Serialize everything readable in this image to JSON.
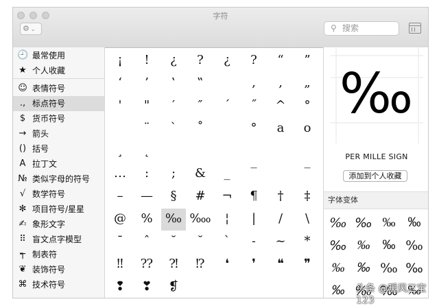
{
  "window": {
    "title": "字符"
  },
  "toolbar": {
    "gear_icon": "⚙",
    "chevron_icon": "⌄",
    "search_placeholder": "搜索",
    "search_icon": "⚲"
  },
  "sidebar": {
    "items": [
      {
        "icon": "🕘",
        "label": "最常使用"
      },
      {
        "icon": "★",
        "label": "个人收藏"
      },
      {
        "icon": "☺",
        "label": "表情符号"
      },
      {
        "icon": ".,",
        "label": "标点符号"
      },
      {
        "icon": "$",
        "label": "货币符号"
      },
      {
        "icon": "→",
        "label": "箭头"
      },
      {
        "icon": "()",
        "label": "括号"
      },
      {
        "icon": "A",
        "label": "拉丁文"
      },
      {
        "icon": "№",
        "label": "类似字母的符号"
      },
      {
        "icon": "√",
        "label": "数学符号"
      },
      {
        "icon": "✻",
        "label": "项目符号/星星"
      },
      {
        "icon": "✍",
        "label": "象形文字"
      },
      {
        "icon": "⠿",
        "label": "盲文点字模型"
      },
      {
        "icon": "┭",
        "label": "制表符"
      },
      {
        "icon": "❦",
        "label": "装饰符号"
      },
      {
        "icon": "⌘",
        "label": "技术符号"
      }
    ],
    "selected_index": 3
  },
  "grid": {
    "rows": [
      [
        "¡",
        "!",
        "¿",
        "?",
        "¿",
        "?",
        "“",
        "”"
      ],
      [
        "‘",
        "’",
        "‛",
        "‟",
        "",
        ",",
        "‚",
        "„"
      ],
      [
        "'",
        "\"",
        "′",
        "″",
        "ˊ",
        "˝",
        "^",
        "°"
      ],
      [
        "",
        "¨",
        "`",
        "˚",
        "",
        "°",
        "a",
        "o"
      ],
      [
        "¸",
        "˛",
        "",
        "",
        "",
        "",
        "",
        ""
      ],
      [
        "…",
        ":",
        ";",
        "&",
        "_",
        "‾",
        "",
        "‾"
      ],
      [
        "–",
        "—",
        "§",
        "#",
        "¬",
        "¶",
        "†",
        "‡"
      ],
      [
        "@",
        "%",
        "‰",
        "‱",
        "¦",
        "|",
        "/",
        "\\"
      ],
      [
        "ˉ",
        "ˆ",
        "˘",
        "˘",
        "ˋ",
        "˗",
        "~",
        "*"
      ],
      [
        "‼",
        "⁇",
        "⁈",
        "⁉",
        "❛",
        "❜",
        "❝",
        "❞"
      ],
      [
        "❢",
        "❣",
        "❡",
        "",
        "",
        "",
        "",
        ""
      ]
    ],
    "selected": "‰"
  },
  "detail": {
    "glyph": "‰",
    "name": "PER MILLE SIGN",
    "add_favorite_label": "添加到个人收藏",
    "variants_title": "字体变体",
    "variants": [
      "‰",
      "‰",
      "‰",
      "‰",
      "‰",
      "‰",
      "‰",
      "‰",
      "‰",
      "‰",
      "‰",
      "‰",
      "‰",
      "‰",
      "‰",
      "‰"
    ]
  },
  "watermark": "头条 @暖风三宝123"
}
